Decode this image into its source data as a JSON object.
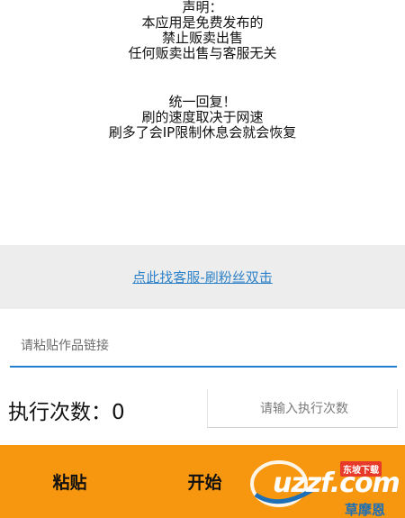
{
  "notice": {
    "lines_top": [
      "声明：",
      "本应用是免费发布的",
      "禁止贩卖出售",
      "任何贩卖出售与客服无关"
    ],
    "lines_bottom": [
      "统一回复！",
      "刷的速度取决于网速",
      "刷多了会IP限制休息会就会恢复"
    ]
  },
  "service": {
    "link_text": "点此找客服-刷粉丝双击"
  },
  "link_input": {
    "placeholder": "请粘贴作品链接",
    "value": ""
  },
  "count": {
    "label": "执行次数：0",
    "placeholder": "请输入执行次数",
    "value": ""
  },
  "actions": {
    "paste_label": "粘贴",
    "start_label": "开始"
  },
  "watermark": {
    "brand": "uzzf.com",
    "tag": "东坡下载",
    "sub": "草摩恩"
  },
  "colors": {
    "bottom_bar": "#f7960f",
    "link": "#2f82c8",
    "input_underline": "#1f7fce",
    "service_bg": "#ededed"
  }
}
